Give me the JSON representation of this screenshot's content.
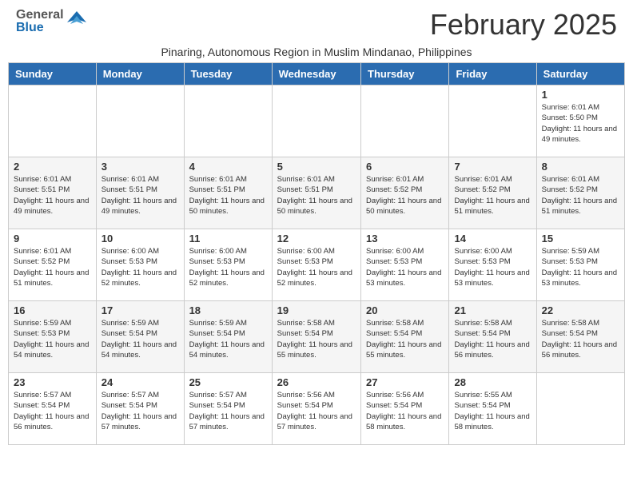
{
  "header": {
    "logo_general": "General",
    "logo_blue": "Blue",
    "month_year": "February 2025",
    "location": "Pinaring, Autonomous Region in Muslim Mindanao, Philippines"
  },
  "days_of_week": [
    "Sunday",
    "Monday",
    "Tuesday",
    "Wednesday",
    "Thursday",
    "Friday",
    "Saturday"
  ],
  "weeks": [
    [
      {
        "day": "",
        "info": ""
      },
      {
        "day": "",
        "info": ""
      },
      {
        "day": "",
        "info": ""
      },
      {
        "day": "",
        "info": ""
      },
      {
        "day": "",
        "info": ""
      },
      {
        "day": "",
        "info": ""
      },
      {
        "day": "1",
        "info": "Sunrise: 6:01 AM\nSunset: 5:50 PM\nDaylight: 11 hours and 49 minutes."
      }
    ],
    [
      {
        "day": "2",
        "info": "Sunrise: 6:01 AM\nSunset: 5:51 PM\nDaylight: 11 hours and 49 minutes."
      },
      {
        "day": "3",
        "info": "Sunrise: 6:01 AM\nSunset: 5:51 PM\nDaylight: 11 hours and 49 minutes."
      },
      {
        "day": "4",
        "info": "Sunrise: 6:01 AM\nSunset: 5:51 PM\nDaylight: 11 hours and 50 minutes."
      },
      {
        "day": "5",
        "info": "Sunrise: 6:01 AM\nSunset: 5:51 PM\nDaylight: 11 hours and 50 minutes."
      },
      {
        "day": "6",
        "info": "Sunrise: 6:01 AM\nSunset: 5:52 PM\nDaylight: 11 hours and 50 minutes."
      },
      {
        "day": "7",
        "info": "Sunrise: 6:01 AM\nSunset: 5:52 PM\nDaylight: 11 hours and 51 minutes."
      },
      {
        "day": "8",
        "info": "Sunrise: 6:01 AM\nSunset: 5:52 PM\nDaylight: 11 hours and 51 minutes."
      }
    ],
    [
      {
        "day": "9",
        "info": "Sunrise: 6:01 AM\nSunset: 5:52 PM\nDaylight: 11 hours and 51 minutes."
      },
      {
        "day": "10",
        "info": "Sunrise: 6:00 AM\nSunset: 5:53 PM\nDaylight: 11 hours and 52 minutes."
      },
      {
        "day": "11",
        "info": "Sunrise: 6:00 AM\nSunset: 5:53 PM\nDaylight: 11 hours and 52 minutes."
      },
      {
        "day": "12",
        "info": "Sunrise: 6:00 AM\nSunset: 5:53 PM\nDaylight: 11 hours and 52 minutes."
      },
      {
        "day": "13",
        "info": "Sunrise: 6:00 AM\nSunset: 5:53 PM\nDaylight: 11 hours and 53 minutes."
      },
      {
        "day": "14",
        "info": "Sunrise: 6:00 AM\nSunset: 5:53 PM\nDaylight: 11 hours and 53 minutes."
      },
      {
        "day": "15",
        "info": "Sunrise: 5:59 AM\nSunset: 5:53 PM\nDaylight: 11 hours and 53 minutes."
      }
    ],
    [
      {
        "day": "16",
        "info": "Sunrise: 5:59 AM\nSunset: 5:53 PM\nDaylight: 11 hours and 54 minutes."
      },
      {
        "day": "17",
        "info": "Sunrise: 5:59 AM\nSunset: 5:54 PM\nDaylight: 11 hours and 54 minutes."
      },
      {
        "day": "18",
        "info": "Sunrise: 5:59 AM\nSunset: 5:54 PM\nDaylight: 11 hours and 54 minutes."
      },
      {
        "day": "19",
        "info": "Sunrise: 5:58 AM\nSunset: 5:54 PM\nDaylight: 11 hours and 55 minutes."
      },
      {
        "day": "20",
        "info": "Sunrise: 5:58 AM\nSunset: 5:54 PM\nDaylight: 11 hours and 55 minutes."
      },
      {
        "day": "21",
        "info": "Sunrise: 5:58 AM\nSunset: 5:54 PM\nDaylight: 11 hours and 56 minutes."
      },
      {
        "day": "22",
        "info": "Sunrise: 5:58 AM\nSunset: 5:54 PM\nDaylight: 11 hours and 56 minutes."
      }
    ],
    [
      {
        "day": "23",
        "info": "Sunrise: 5:57 AM\nSunset: 5:54 PM\nDaylight: 11 hours and 56 minutes."
      },
      {
        "day": "24",
        "info": "Sunrise: 5:57 AM\nSunset: 5:54 PM\nDaylight: 11 hours and 57 minutes."
      },
      {
        "day": "25",
        "info": "Sunrise: 5:57 AM\nSunset: 5:54 PM\nDaylight: 11 hours and 57 minutes."
      },
      {
        "day": "26",
        "info": "Sunrise: 5:56 AM\nSunset: 5:54 PM\nDaylight: 11 hours and 57 minutes."
      },
      {
        "day": "27",
        "info": "Sunrise: 5:56 AM\nSunset: 5:54 PM\nDaylight: 11 hours and 58 minutes."
      },
      {
        "day": "28",
        "info": "Sunrise: 5:55 AM\nSunset: 5:54 PM\nDaylight: 11 hours and 58 minutes."
      },
      {
        "day": "",
        "info": ""
      }
    ]
  ]
}
